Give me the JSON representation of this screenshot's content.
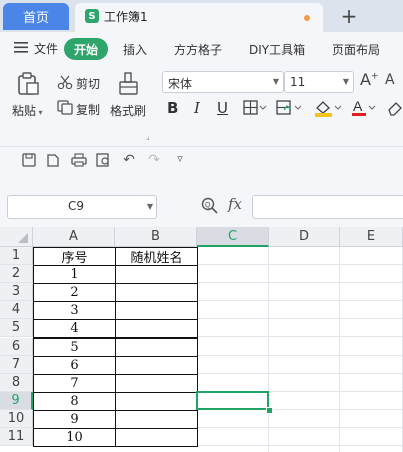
{
  "tabs": {
    "home": "首页",
    "book_icon": "S",
    "book_title": "工作簿1",
    "add_icon": "plus-icon"
  },
  "menu": {
    "file": "文件",
    "items": [
      "开始",
      "插入",
      "方方格子",
      "DIY工具箱",
      "页面布局"
    ]
  },
  "toolbar": {
    "paste": "粘贴",
    "cut": "剪切",
    "copy": "复制",
    "format_painter": "格式刷",
    "font_name": "宋体",
    "font_size": "11",
    "colors": {
      "fill": "#f5c518",
      "font": "#e02020",
      "accent": "#2ea56b",
      "tab_home": "#4a86e8",
      "selection": "#21a366"
    }
  },
  "formula_bar": {
    "name_box": "C9",
    "fx": "fx",
    "content": ""
  },
  "sheet": {
    "columns": [
      "A",
      "B",
      "C",
      "D",
      "E"
    ],
    "active_column": "C",
    "active_row": "9",
    "selected_cell": "C9",
    "rows": [
      {
        "n": "1",
        "a": "序号",
        "b": "随机姓名"
      },
      {
        "n": "2",
        "a": "1",
        "b": ""
      },
      {
        "n": "3",
        "a": "2",
        "b": ""
      },
      {
        "n": "4",
        "a": "3",
        "b": ""
      },
      {
        "n": "5",
        "a": "4",
        "b": ""
      },
      {
        "n": "6",
        "a": "5",
        "b": ""
      },
      {
        "n": "7",
        "a": "6",
        "b": ""
      },
      {
        "n": "8",
        "a": "7",
        "b": ""
      },
      {
        "n": "9",
        "a": "8",
        "b": ""
      },
      {
        "n": "10",
        "a": "9",
        "b": ""
      },
      {
        "n": "11",
        "a": "10",
        "b": ""
      }
    ]
  }
}
